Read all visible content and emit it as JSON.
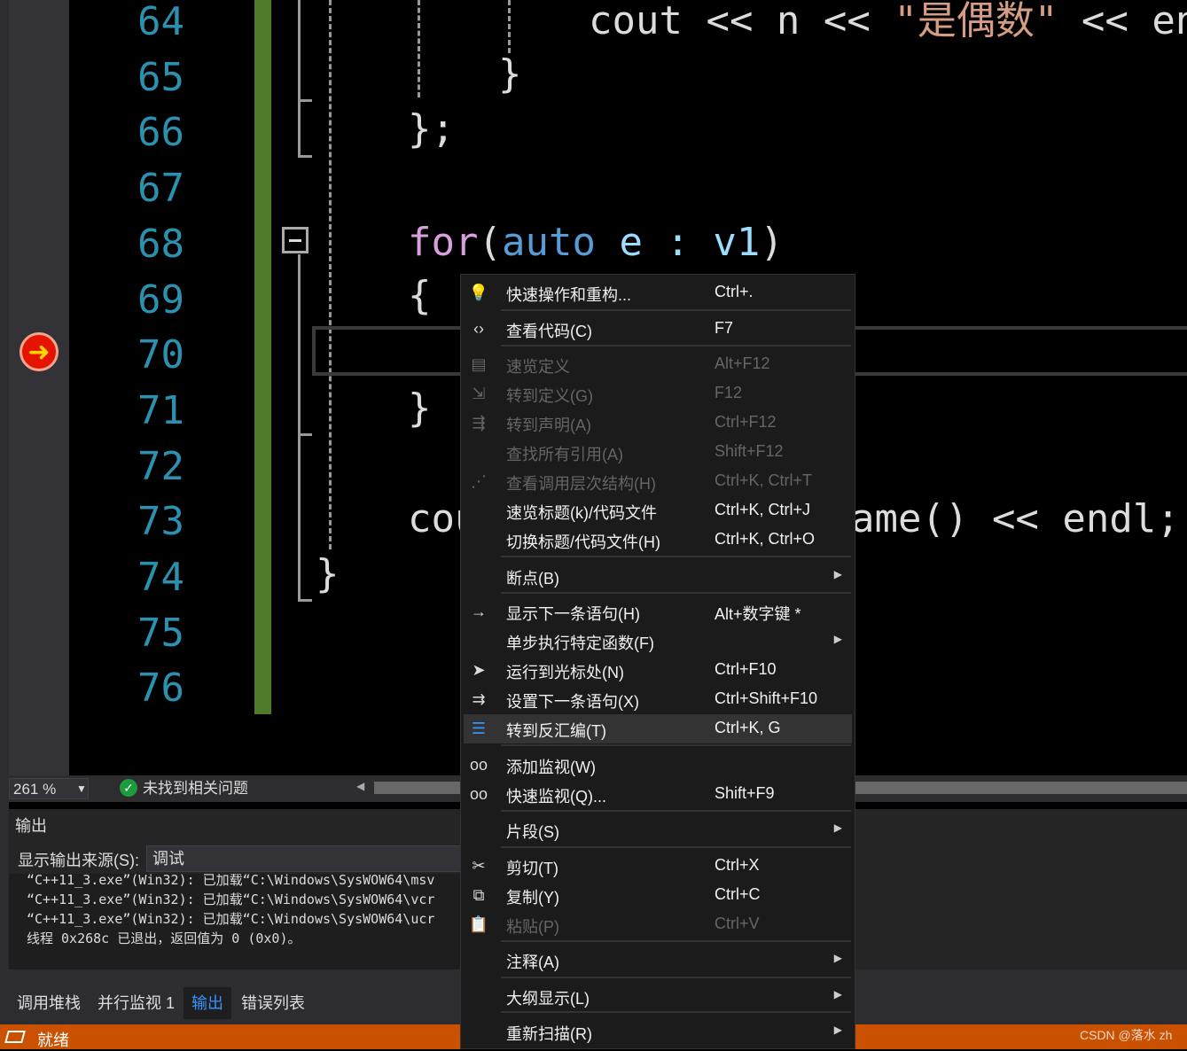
{
  "editor": {
    "line_numbers": [
      "64",
      "65",
      "66",
      "67",
      "68",
      "69",
      "70",
      "71",
      "72",
      "73",
      "74",
      "75",
      "76"
    ],
    "code": {
      "line64_a": "cout << n << ",
      "line64_str": "\"是偶数\"",
      "line64_b": " << en",
      "line65": "}",
      "line66": "};",
      "line68_kw": "for",
      "line68_paren": "(",
      "line68_auto": "auto",
      "line68_rest_a": " e : ",
      "line68_v1": "v1",
      "line68_close": ")",
      "line69": "{",
      "line71": "}",
      "line73_a": "cou",
      "line73_b": "ame() << endl;",
      "line74": "}"
    }
  },
  "footer": {
    "zoom": "261 %",
    "issues": "未找到相关问题"
  },
  "output": {
    "title": "输出",
    "source_label": "显示输出来源(S):",
    "source_value": "调试",
    "lines": [
      "“C++11_3.exe”(Win32): 已加载“C:\\Windows\\SysWOW64\\msv",
      "“C++11_3.exe”(Win32): 已加载“C:\\Windows\\SysWOW64\\vcr",
      "“C++11_3.exe”(Win32): 已加载“C:\\Windows\\SysWOW64\\ucr",
      "线程 0x268c 已退出，返回值为 0 (0x0)。"
    ]
  },
  "tabs": [
    "调用堆栈",
    "并行监视 1",
    "输出",
    "错误列表"
  ],
  "status": {
    "text": "就绪",
    "watermark": "CSDN @落水 zh"
  },
  "menu": [
    {
      "label": "快速操作和重构...",
      "shortcut": "Ctrl+.",
      "icon": "lightbulb-icon",
      "glyph": "💡",
      "state": "enabled"
    },
    {
      "label": "查看代码(C)",
      "shortcut": "F7",
      "icon": "code-brackets-icon",
      "glyph": "‹›",
      "state": "enabled"
    },
    {
      "label": "速览定义",
      "shortcut": "Alt+F12",
      "icon": "peek-definition-icon",
      "glyph": "▤",
      "state": "disabled"
    },
    {
      "label": "转到定义(G)",
      "shortcut": "F12",
      "icon": "go-to-definition-icon",
      "glyph": "⇲",
      "state": "disabled"
    },
    {
      "label": "转到声明(A)",
      "shortcut": "Ctrl+F12",
      "icon": "go-to-declaration-icon",
      "glyph": "⇶",
      "state": "disabled"
    },
    {
      "label": "查找所有引用(A)",
      "shortcut": "Shift+F12",
      "icon": "",
      "glyph": "",
      "state": "disabled"
    },
    {
      "label": "查看调用层次结构(H)",
      "shortcut": "Ctrl+K, Ctrl+T",
      "icon": "call-hierarchy-icon",
      "glyph": "⋰",
      "state": "disabled"
    },
    {
      "label": "速览标题(k)/代码文件",
      "shortcut": "Ctrl+K, Ctrl+J",
      "icon": "",
      "glyph": "",
      "state": "enabled"
    },
    {
      "label": "切换标题/代码文件(H)",
      "shortcut": "Ctrl+K, Ctrl+O",
      "icon": "",
      "glyph": "",
      "state": "enabled"
    },
    {
      "label": "断点(B)",
      "shortcut": "",
      "icon": "",
      "glyph": "",
      "state": "enabled",
      "submenu": true
    },
    {
      "label": "显示下一条语句(H)",
      "shortcut": "Alt+数字键 *",
      "icon": "arrow-right-icon",
      "glyph": "→",
      "state": "enabled"
    },
    {
      "label": "单步执行特定函数(F)",
      "shortcut": "",
      "icon": "",
      "glyph": "",
      "state": "enabled",
      "submenu": true
    },
    {
      "label": "运行到光标处(N)",
      "shortcut": "Ctrl+F10",
      "icon": "cursor-icon",
      "glyph": "➤",
      "state": "enabled"
    },
    {
      "label": "设置下一条语句(X)",
      "shortcut": "Ctrl+Shift+F10",
      "icon": "set-next-statement-icon",
      "glyph": "⇉",
      "state": "enabled"
    },
    {
      "label": "转到反汇编(T)",
      "shortcut": "Ctrl+K, G",
      "icon": "disassembly-icon",
      "glyph": "☰",
      "state": "highlighted"
    },
    {
      "label": "添加监视(W)",
      "shortcut": "",
      "icon": "glasses-icon",
      "glyph": "oo",
      "state": "enabled"
    },
    {
      "label": "快速监视(Q)...",
      "shortcut": "Shift+F9",
      "icon": "glasses-icon",
      "glyph": "oo",
      "state": "enabled"
    },
    {
      "label": "片段(S)",
      "shortcut": "",
      "icon": "",
      "glyph": "",
      "state": "enabled",
      "submenu": true
    },
    {
      "label": "剪切(T)",
      "shortcut": "Ctrl+X",
      "icon": "scissors-icon",
      "glyph": "✂",
      "state": "enabled"
    },
    {
      "label": "复制(Y)",
      "shortcut": "Ctrl+C",
      "icon": "copy-icon",
      "glyph": "⧉",
      "state": "enabled"
    },
    {
      "label": "粘贴(P)",
      "shortcut": "Ctrl+V",
      "icon": "paste-icon",
      "glyph": "📋",
      "state": "disabled"
    },
    {
      "label": "注释(A)",
      "shortcut": "",
      "icon": "",
      "glyph": "",
      "state": "enabled",
      "submenu": true
    },
    {
      "label": "大纲显示(L)",
      "shortcut": "",
      "icon": "",
      "glyph": "",
      "state": "enabled",
      "submenu": true
    },
    {
      "label": "重新扫描(R)",
      "shortcut": "",
      "icon": "",
      "glyph": "",
      "state": "enabled",
      "submenu": true
    }
  ]
}
